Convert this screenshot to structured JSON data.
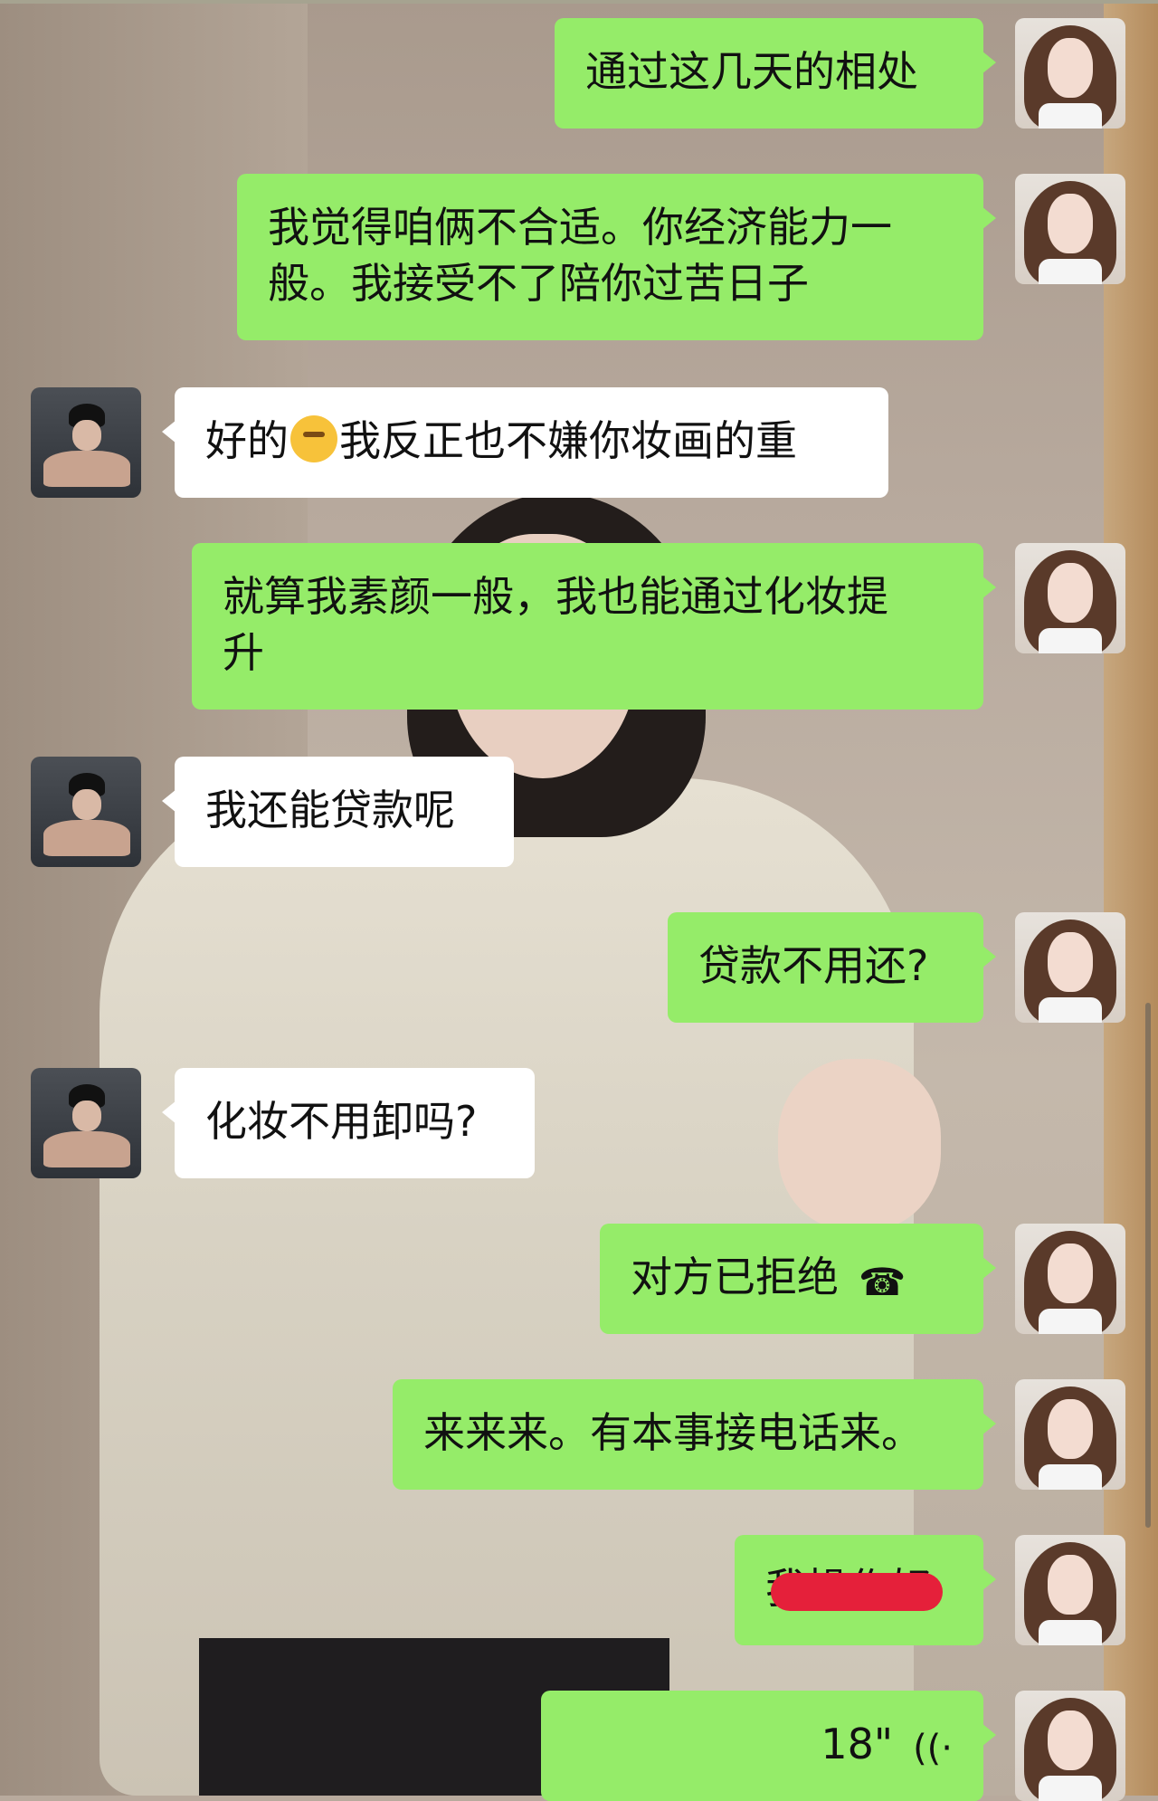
{
  "messages": [
    {
      "side": "right",
      "text": "通过这几天的相处"
    },
    {
      "side": "right",
      "text": "我觉得咱俩不合适。你经济能力一\n般。我接受不了陪你过苦日子"
    },
    {
      "side": "left",
      "text_before": "好的",
      "emoji": "smirk-emoji",
      "text_after": "我反正也不嫌你妆画的重"
    },
    {
      "side": "right",
      "text": "就算我素颜一般，我也能通过化妆提\n升"
    },
    {
      "side": "left",
      "text": "我还能贷款呢"
    },
    {
      "side": "right",
      "text": "贷款不用还?"
    },
    {
      "side": "left",
      "text": "化妆不用卸吗?"
    },
    {
      "side": "right",
      "text": "对方已拒绝",
      "icon": "call-declined-icon",
      "icon_glyph": "☎"
    },
    {
      "side": "right",
      "text": "来来来。有本事接电话来。"
    },
    {
      "side": "right",
      "text": "我操作好",
      "redacted": true
    },
    {
      "side": "right",
      "text": "18\"",
      "icon": "voice-wave-icon",
      "icon_glyph": "((·"
    }
  ],
  "colors": {
    "sent_bubble": "#95ec69",
    "received_bubble": "#ffffff"
  }
}
